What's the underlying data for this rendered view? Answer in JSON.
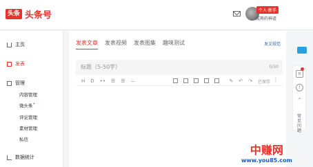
{
  "header": {
    "logo_box": "头条",
    "logo_text": "头条号",
    "badge": "个人·新手",
    "username": "成熟的神道"
  },
  "sidebar": {
    "home": "主页",
    "publish": "发表",
    "manage": "管理",
    "sub": [
      "内容管理",
      "微头条",
      "评论管理",
      "素材管理",
      "私信"
    ],
    "data": "数据统计"
  },
  "main": {
    "tabs": [
      "发表文章",
      "发表视频",
      "发表图集",
      "趣味测试"
    ],
    "guide_link": "发文规范",
    "title_placeholder": "标题（5-50字）",
    "title_count": "0/50",
    "toolbar_items": [
      "H",
      "D",
      "••",
      "☰",
      "☰",
      "—"
    ],
    "saved": "已保存"
  },
  "rightbar": {
    "text": "常见问题"
  },
  "watermark": {
    "title": "中赚网",
    "url": "www.you85.com"
  }
}
